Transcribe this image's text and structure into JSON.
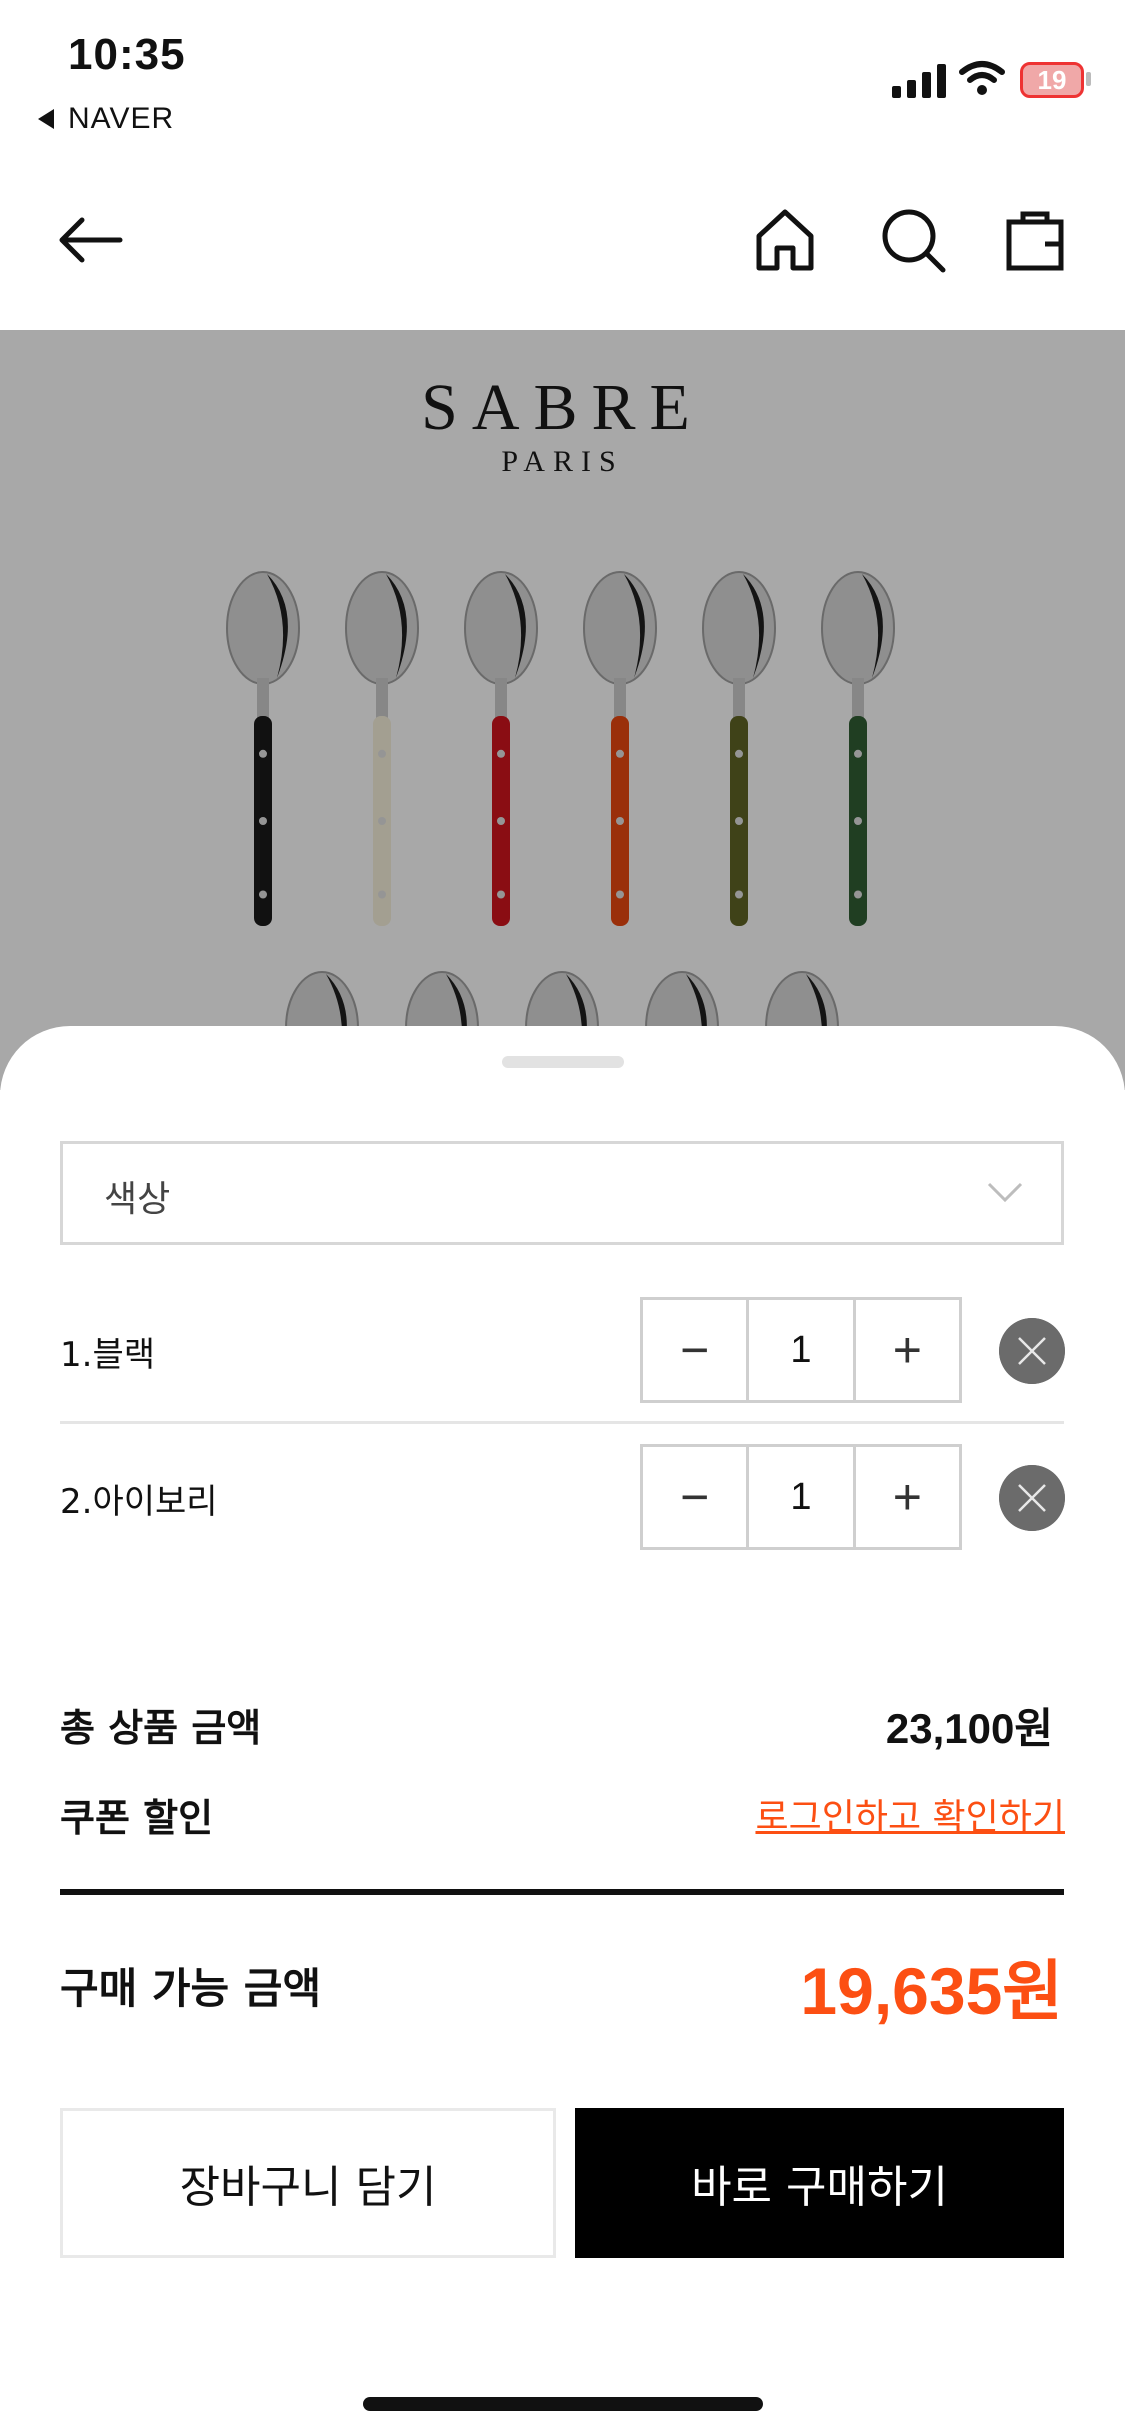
{
  "status_bar": {
    "time": "10:35",
    "back_app": "NAVER",
    "battery": "19"
  },
  "header": {
    "back_icon": "arrow-left-icon",
    "home_icon": "home-icon",
    "search_icon": "search-icon",
    "bag_icon": "shopping-bag-icon"
  },
  "product_image": {
    "brand": "SABRE",
    "brand_sub": "PARIS",
    "spoon_colors": [
      "#1a1a1a",
      "#ece6d3",
      "#c8141c",
      "#e0450f",
      "#5c6024",
      "#2f5a32"
    ]
  },
  "options": {
    "select_placeholder": "색상",
    "items": [
      {
        "label": "1.블랙",
        "quantity": "1"
      },
      {
        "label": "2.아이보리",
        "quantity": "1"
      }
    ]
  },
  "summary": {
    "total_label": "총 상품 금액",
    "total_value": "23,100원",
    "coupon_label": "쿠폰 할인",
    "coupon_link": "로그인하고 확인하기",
    "final_label": "구매 가능 금액",
    "final_value": "19,635원"
  },
  "actions": {
    "cart_label": "장바구니 담기",
    "buy_label": "바로 구매하기"
  },
  "colors": {
    "accent": "#fc4f13",
    "primary_button": "#000000"
  }
}
